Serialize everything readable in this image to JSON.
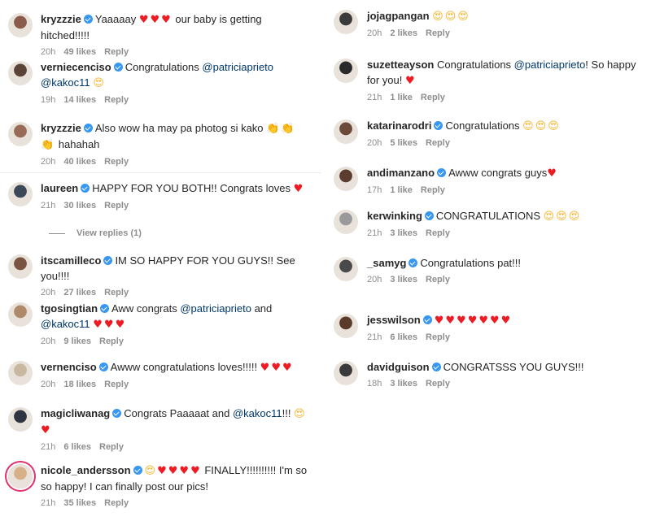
{
  "left": [
    {
      "user": "kryzzzie",
      "verified": true,
      "parts": [
        {
          "t": "Yaaaaay "
        },
        {
          "e": "♥♥♥",
          "k": "heart"
        },
        {
          "t": " our baby is getting hitched!!!!!"
        }
      ],
      "time": "20h",
      "likes": "49 likes",
      "reply": "Reply"
    },
    {
      "user": "verniecenciso",
      "verified": true,
      "parts": [
        {
          "t": "Congratulations "
        },
        {
          "m": "@patriciaprieto"
        },
        {
          "t": " "
        },
        {
          "m": "@kakoc11"
        },
        {
          "t": " "
        },
        {
          "e": "😍",
          "k": "eyes"
        }
      ],
      "time": "19h",
      "likes": "14 likes",
      "reply": "Reply"
    },
    {
      "user": "kryzzzie",
      "verified": true,
      "parts": [
        {
          "t": "Also wow ha may pa photog si kako "
        },
        {
          "e": "👏👏👏",
          "k": "clap"
        },
        {
          "t": " hahahah"
        }
      ],
      "time": "20h",
      "likes": "40 likes",
      "reply": "Reply"
    },
    {
      "user": "laureen",
      "verified": true,
      "parts": [
        {
          "t": "HAPPY FOR YOU BOTH!! Congrats loves "
        },
        {
          "e": "♥",
          "k": "heart"
        }
      ],
      "time": "21h",
      "likes": "30 likes",
      "reply": "Reply"
    },
    {
      "user": "itscamilleco",
      "verified": true,
      "parts": [
        {
          "t": "IM SO HAPPY FOR YOU GUYS!! See you!!!!"
        }
      ],
      "time": "20h",
      "likes": "27 likes",
      "reply": "Reply"
    },
    {
      "user": "tgosingtian",
      "verified": true,
      "parts": [
        {
          "t": "Aww congrats "
        },
        {
          "m": "@patriciaprieto"
        },
        {
          "t": " and "
        },
        {
          "m": "@kakoc11"
        },
        {
          "t": " "
        },
        {
          "e": "♥♥♥",
          "k": "heart"
        }
      ],
      "time": "20h",
      "likes": "9 likes",
      "reply": "Reply"
    },
    {
      "user": "vernenciso",
      "verified": true,
      "parts": [
        {
          "t": "Awww congratulations loves!!!!! "
        },
        {
          "e": "♥♥♥",
          "k": "heart"
        }
      ],
      "time": "20h",
      "likes": "18 likes",
      "reply": "Reply"
    },
    {
      "user": "magicliwanag",
      "verified": true,
      "parts": [
        {
          "t": "Congrats Paaaaat and "
        },
        {
          "m": "@kakoc11"
        },
        {
          "t": "!!! "
        },
        {
          "e": "😍",
          "k": "eyes"
        },
        {
          "e": "♥",
          "k": "heart"
        }
      ],
      "time": "21h",
      "likes": "6 likes",
      "reply": "Reply"
    },
    {
      "user": "nicole_andersson",
      "verified": true,
      "parts": [
        {
          "e": "😍",
          "k": "eyes"
        },
        {
          "e": "♥♥♥♥",
          "k": "heart"
        },
        {
          "t": " FINALLY!!!!!!!!!! I'm so so happy! I can finally post our pics!"
        }
      ],
      "time": "21h",
      "likes": "35 likes",
      "reply": "Reply"
    }
  ],
  "view_replies": "View replies (1)",
  "right": [
    {
      "user": "jojagpangan",
      "verified": false,
      "parts": [
        {
          "e": "😍😍😍",
          "k": "eyes"
        }
      ],
      "time": "20h",
      "likes": "2 likes",
      "reply": "Reply"
    },
    {
      "user": "suzetteayson",
      "verified": false,
      "parts": [
        {
          "t": "Congratulations "
        },
        {
          "m": "@patriciaprieto"
        },
        {
          "t": "! So happy for you! "
        },
        {
          "e": "♥",
          "k": "heart"
        }
      ],
      "time": "21h",
      "likes": "1 like",
      "reply": "Reply"
    },
    {
      "user": "katarinarodri",
      "verified": true,
      "parts": [
        {
          "t": "Congratulations "
        },
        {
          "e": "😍😍😍",
          "k": "eyes"
        }
      ],
      "time": "20h",
      "likes": "5 likes",
      "reply": "Reply"
    },
    {
      "user": "andimanzano",
      "verified": true,
      "parts": [
        {
          "t": "Awww congrats guys"
        },
        {
          "e": "♥",
          "k": "heart"
        }
      ],
      "time": "17h",
      "likes": "1 like",
      "reply": "Reply"
    },
    {
      "user": "kerwinking",
      "verified": true,
      "parts": [
        {
          "t": "CONGRATULATIONS "
        },
        {
          "e": "😍😍😍",
          "k": "eyes"
        }
      ],
      "time": "21h",
      "likes": "3 likes",
      "reply": "Reply"
    },
    {
      "user": "_samyg",
      "verified": true,
      "parts": [
        {
          "t": "Congratulations pat!!!"
        }
      ],
      "time": "20h",
      "likes": "3 likes",
      "reply": "Reply"
    },
    {
      "user": "jesswilson",
      "verified": true,
      "parts": [
        {
          "e": "♥♥♥♥♥♥♥",
          "k": "heart"
        }
      ],
      "time": "21h",
      "likes": "6 likes",
      "reply": "Reply"
    },
    {
      "user": "davidguison",
      "verified": true,
      "parts": [
        {
          "t": "CONGRATSSS YOU GUYS!!!"
        }
      ],
      "time": "18h",
      "likes": "3 likes",
      "reply": "Reply"
    }
  ],
  "colors": {
    "verified": "#3897f0",
    "mention": "#00376b",
    "heart": "#ed1c24",
    "meta": "#8e8e8e",
    "story_ring": "#e1306c"
  }
}
